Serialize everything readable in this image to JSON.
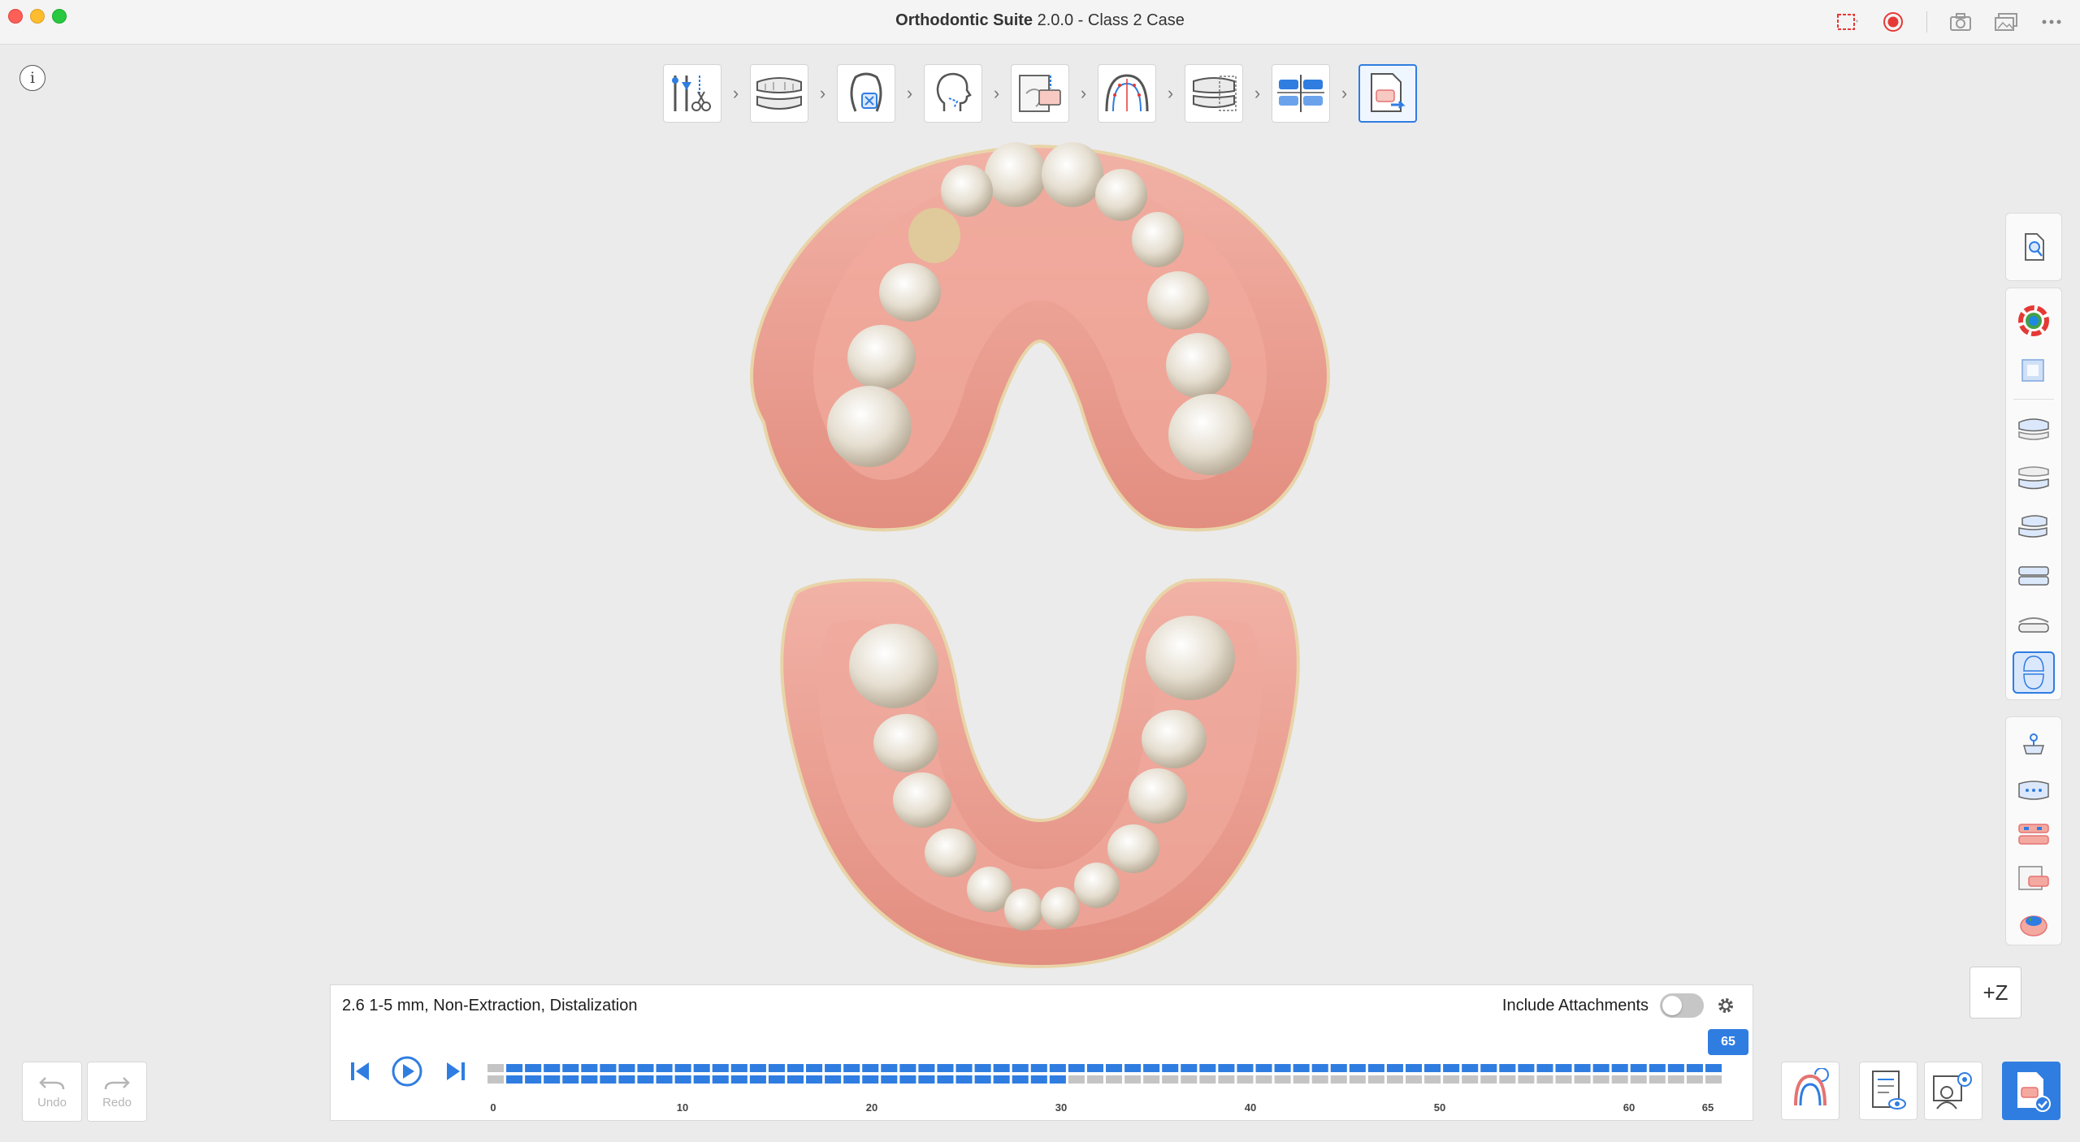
{
  "window": {
    "app_name": "Orthodontic Suite",
    "version_and_case": "2.0.0 - Class 2 Case"
  },
  "titlebar_icons": [
    "fullscreen-icon",
    "record-icon",
    "camera-icon",
    "gallery-icon",
    "more-icon"
  ],
  "workflow_steps": [
    {
      "name": "setup-tools-icon",
      "active": false
    },
    {
      "name": "scan-import-icon",
      "active": false
    },
    {
      "name": "tooth-segmentation-icon",
      "active": false
    },
    {
      "name": "face-profile-icon",
      "active": false
    },
    {
      "name": "cephalometric-icon",
      "active": false
    },
    {
      "name": "arch-form-icon",
      "active": false
    },
    {
      "name": "treatment-planning-icon",
      "active": false
    },
    {
      "name": "occlusion-alignment-icon",
      "active": false
    },
    {
      "name": "export-report-icon",
      "active": true
    }
  ],
  "right_palette": {
    "group1": [
      "case-info-icon"
    ],
    "group2": [
      "color-map-icon",
      "transparency-icon",
      "upper-jaw-view-icon",
      "lower-jaw-view-icon",
      "both-jaws-view-icon",
      "jaw-front-view-icon",
      "jaw-side-view-icon",
      "occlusal-view-icon"
    ],
    "group3": [
      "superimpose-icon",
      "ipr-view-icon",
      "attachment-view-icon",
      "bite-ramp-icon",
      "gum-icon"
    ],
    "active": "occlusal-view-icon"
  },
  "z_button": {
    "label": "+Z"
  },
  "playback": {
    "case_description": "2.6 1-5 mm, Non-Extraction, Distalization",
    "include_attachments_label": "Include Attachments",
    "include_attachments": false,
    "current_step": "65",
    "total_steps": 65,
    "lower_track_filled": 30,
    "tick_labels": [
      "0",
      "10",
      "20",
      "30",
      "40",
      "50",
      "60",
      "65"
    ]
  },
  "undo": {
    "label": "Undo"
  },
  "redo": {
    "label": "Redo"
  },
  "colors": {
    "accent": "#2f7de1",
    "gum": "#e99c8e",
    "tooth": "#ebe6dc",
    "track_inactive": "#c4c4c4"
  }
}
